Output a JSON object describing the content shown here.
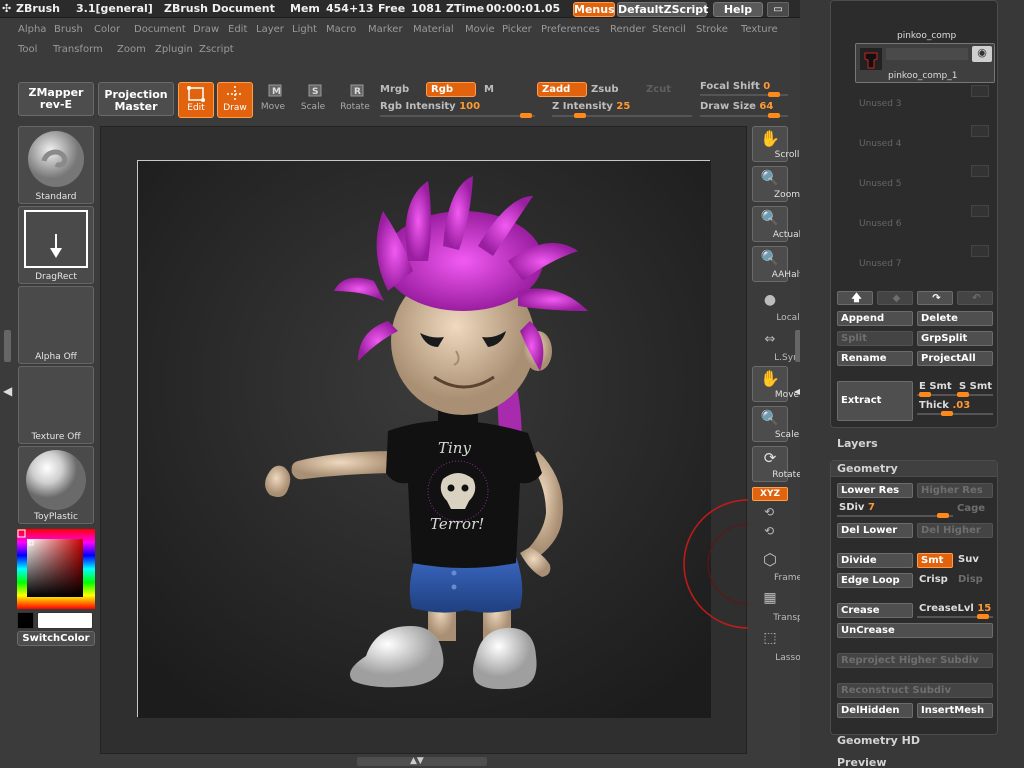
{
  "titlebar": {
    "app": "ZBrush",
    "version": "3.1[general]",
    "document": "ZBrush Document",
    "mem_label": "Mem",
    "mem_value": "454+13",
    "free_label": "Free",
    "free_value": "1081",
    "ztime_label": "ZTime",
    "ztime_value": "00:00:01.05",
    "menus_button": "Menus",
    "script_button": "DefaultZScript",
    "help_button": "Help"
  },
  "menu_row1": [
    "Alpha",
    "Brush",
    "Color",
    "Document",
    "Draw",
    "Edit",
    "Layer",
    "Light",
    "Macro",
    "Marker",
    "Material",
    "Movie",
    "Picker",
    "Preferences",
    "Render",
    "Stencil",
    "Stroke",
    "Texture"
  ],
  "menu_row2": [
    "Tool",
    "Transform",
    "Zoom",
    "Zplugin",
    "Zscript"
  ],
  "topbar": {
    "zmapper_line1": "ZMapper",
    "zmapper_line2": "rev-E",
    "projection_line1": "Projection",
    "projection_line2": "Master",
    "tools": {
      "edit": "Edit",
      "draw": "Draw",
      "move": "Move",
      "scale": "Scale",
      "rotate": "Rotate"
    },
    "mrgb": "Mrgb",
    "rgb": "Rgb",
    "m": "M",
    "zadd": "Zadd",
    "zsub": "Zsub",
    "zcut": "Zcut",
    "rgb_intensity_label": "Rgb Intensity",
    "rgb_intensity_value": "100",
    "z_intensity_label": "Z Intensity",
    "z_intensity_value": "25",
    "focal_shift_label": "Focal Shift",
    "focal_shift_value": "0",
    "draw_size_label": "Draw Size",
    "draw_size_value": "64"
  },
  "left_shelf": {
    "brush": "Standard",
    "stroke": "DragRect",
    "alpha": "Alpha Off",
    "texture": "Texture Off",
    "material": "ToyPlastic",
    "switch_color": "SwitchColor"
  },
  "right_shelf": {
    "scroll": "Scroll",
    "zoom": "Zoom",
    "actual": "Actual",
    "aahalf": "AAHalf",
    "local": "Local",
    "lsym": "L.Sym",
    "move": "Move",
    "scale": "Scale",
    "rotate": "Rotate",
    "xyz": "XYZ",
    "frame": "Frame",
    "transp": "Transp",
    "lasso": "Lasso"
  },
  "subtools": {
    "top_name": "pinkoo_comp",
    "selected_name": "pinkoo_comp_1",
    "unused": [
      "Unused 3",
      "Unused 4",
      "Unused 5",
      "Unused 6",
      "Unused 7"
    ],
    "append": "Append",
    "delete": "Delete",
    "split": "Split",
    "grpsplit": "GrpSplit",
    "rename": "Rename",
    "projectall": "ProjectAll",
    "extract": "Extract",
    "e_smt": "E Smt",
    "s_smt": "S Smt",
    "thick_label": "Thick",
    "thick_value": ".03"
  },
  "layers_header": "Layers",
  "geometry": {
    "header": "Geometry",
    "lower_res": "Lower Res",
    "higher_res": "Higher Res",
    "sdiv_label": "SDiv",
    "sdiv_value": "7",
    "cage": "Cage",
    "del_lower": "Del Lower",
    "del_higher": "Del Higher",
    "divide": "Divide",
    "smt": "Smt",
    "suv": "Suv",
    "edge_loop": "Edge Loop",
    "crisp": "Crisp",
    "disp": "Disp",
    "crease": "Crease",
    "creaselvl_label": "CreaseLvl",
    "creaselvl_value": "15",
    "uncrease": "UnCrease",
    "reproject": "Reproject Higher Subdiv",
    "reconstruct": "Reconstruct Subdiv",
    "delhidden": "DelHidden",
    "insertmesh": "InsertMesh"
  },
  "geometry_hd_header": "Geometry HD",
  "preview_header": "Preview",
  "shirt_text_line1": "Tiny",
  "shirt_text_line2": "Terror!",
  "colors": {
    "accent": "#e2630e",
    "hair": "#d23ad6",
    "shirt": "#111111",
    "shorts": "#2d57a8",
    "skin": "#d9c1a5"
  }
}
